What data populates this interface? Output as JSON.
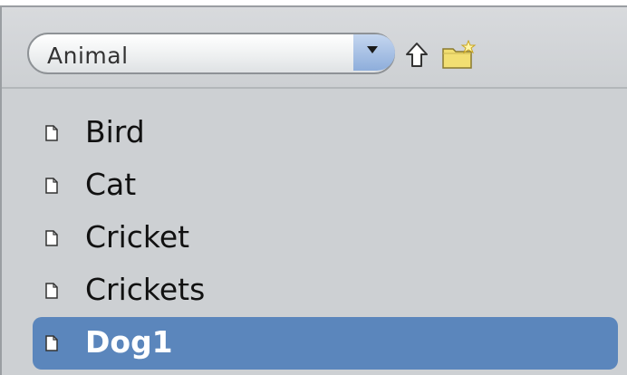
{
  "path_selector": {
    "selected_value": "Animal"
  },
  "toolbar": {
    "up_icon": "up-arrow-icon",
    "new_folder_icon": "new-folder-icon"
  },
  "file_list": {
    "items": [
      {
        "label": "Bird",
        "icon": "document-icon",
        "selected": false
      },
      {
        "label": "Cat",
        "icon": "document-icon",
        "selected": false
      },
      {
        "label": "Cricket",
        "icon": "document-icon",
        "selected": false
      },
      {
        "label": "Crickets",
        "icon": "document-icon",
        "selected": false
      },
      {
        "label": "Dog1",
        "icon": "document-icon",
        "selected": true
      }
    ]
  },
  "colors": {
    "panel_background": "#cdd0d3",
    "selection": "#5b86bc",
    "dropdown_button": "#8eaedb",
    "folder": "#f2df72"
  }
}
